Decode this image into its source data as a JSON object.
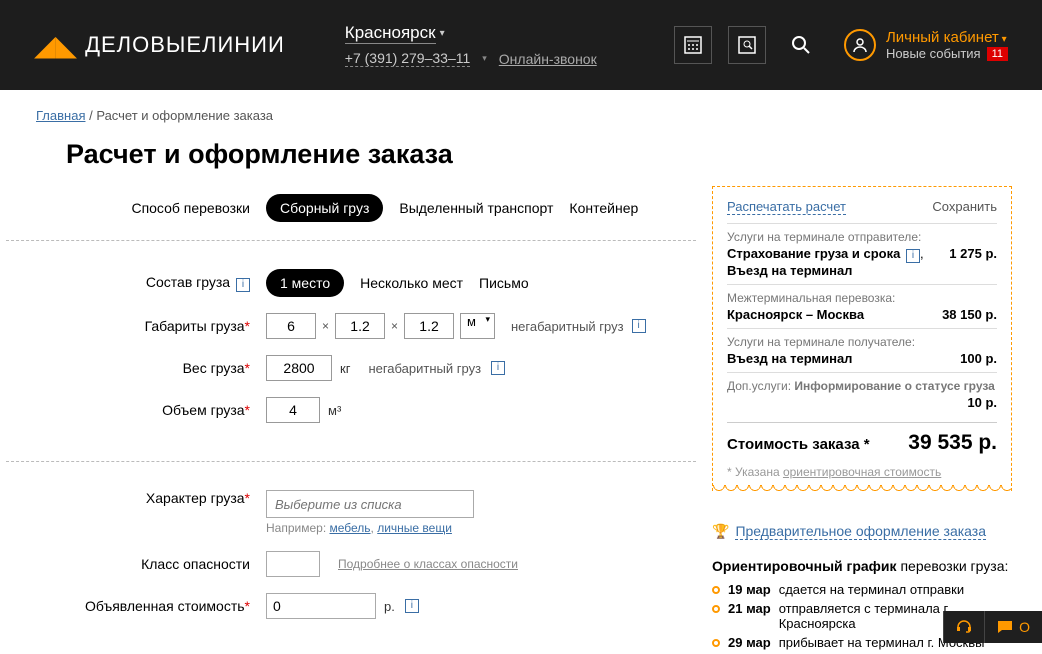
{
  "header": {
    "logo_text": "ДЕЛОВЫЕЛИНИИ",
    "city": "Красноярск",
    "phone": "+7 (391) 279–33–11",
    "online_call": "Онлайн-звонок",
    "cabinet": "Личный кабинет",
    "events": "Новые события",
    "events_count": "11"
  },
  "crumbs": {
    "home": "Главная",
    "sep": " / ",
    "current": "Расчет и оформление заказа"
  },
  "page_title": "Расчет и оформление заказа",
  "shipping": {
    "label": "Способ перевозки",
    "opt1": "Сборный груз",
    "opt2": "Выделенный транспорт",
    "opt3": "Контейнер"
  },
  "cargo": {
    "compose_label": "Состав груза",
    "c1": "1 место",
    "c2": "Несколько мест",
    "c3": "Письмо",
    "dims_label": "Габариты груза",
    "dim1": "6",
    "dim2": "1.2",
    "dim3": "1.2",
    "dim_mult": "×",
    "dim_unit": "м",
    "oversize": "негабаритный груз",
    "weight_label": "Вес груза",
    "weight": "2800",
    "weight_unit": "кг",
    "volume_label": "Объем груза",
    "volume": "4",
    "volume_unit": "м³"
  },
  "details": {
    "nature_label": "Характер груза",
    "nature_placeholder": "Выберите из списка",
    "example_prefix": "Например: ",
    "ex1": "мебель",
    "ex_sep": ", ",
    "ex2": "личные вещи",
    "danger_label": "Класс опасности",
    "danger_link": "Подробнее о классах опасности",
    "declared_label": "Объявленная стоимость",
    "declared_val": "0",
    "declared_unit": "р."
  },
  "receipt": {
    "print": "Распечатать расчет",
    "save": "Сохранить",
    "s1h": "Услуги на терминале отправителе:",
    "s1a": "Страхование груза и срока",
    "s1b": "Въезд на терминал",
    "s1p": "1 275 р.",
    "s2h": "Межтерминальная перевозка:",
    "s2a": "Красноярск – Москва",
    "s2p": "38 150 р.",
    "s3h": "Услуги на терминале получателе:",
    "s3a": "Въезд на терминал",
    "s3p": "100 р.",
    "s4h": "Доп.услуги:",
    "s4a": "Информирование о статусе груза",
    "s4p": "10 р.",
    "total_label": "Стоимость заказа *",
    "total_price": "39 535 р.",
    "footnote_prefix": "* Указана ",
    "footnote_link": "ориентировочная стоимость"
  },
  "preorder": "Предварительное оформление заказа",
  "schedule": {
    "title_bold": "Ориентировочный график",
    "title_rest": " перевозки груза:",
    "d1": "19 мар",
    "t1": "сдается на терминал отправки",
    "d2": "21 мар",
    "t2": "отправляется с терминала г. Красноярска",
    "d3": "29 мар",
    "t3": "прибывает на терминал г. Москвы"
  },
  "chat": {
    "label": "О"
  }
}
